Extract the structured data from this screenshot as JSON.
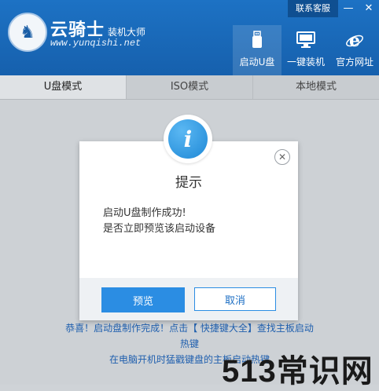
{
  "app": {
    "brand_name": "云骑士",
    "brand_sub": "装机大师",
    "url": "www.yunqishi.net"
  },
  "top_bar": {
    "support": "联系客服",
    "minimize": "—",
    "close": "✕"
  },
  "nav": [
    {
      "label": "启动U盘",
      "icon": "usb-icon",
      "active": true
    },
    {
      "label": "一键装机",
      "icon": "monitor-icon",
      "active": false
    },
    {
      "label": "官方网址",
      "icon": "ie-icon",
      "active": false
    }
  ],
  "tabs": [
    {
      "label": "U盘模式",
      "active": true
    },
    {
      "label": "ISO模式",
      "active": false
    },
    {
      "label": "本地模式",
      "active": false
    }
  ],
  "dialog": {
    "icon": "info-icon",
    "icon_glyph": "i",
    "title": "提示",
    "message_line1": "启动U盘制作成功!",
    "message_line2": "是否立即预览该启动设备",
    "preview_label": "预览",
    "cancel_label": "取消",
    "close_glyph": "✕"
  },
  "bottom": {
    "line1": "恭喜！启动盘制作完成！点击【 快捷键大全】查找主板启动",
    "line2": "热键",
    "line3": "在电脑开机时猛戳键盘的主板启动热键"
  },
  "watermark": "513常识网",
  "colors": {
    "header": "#1d72c4",
    "accent": "#2b8de3",
    "link_text": "#1f5fae"
  }
}
